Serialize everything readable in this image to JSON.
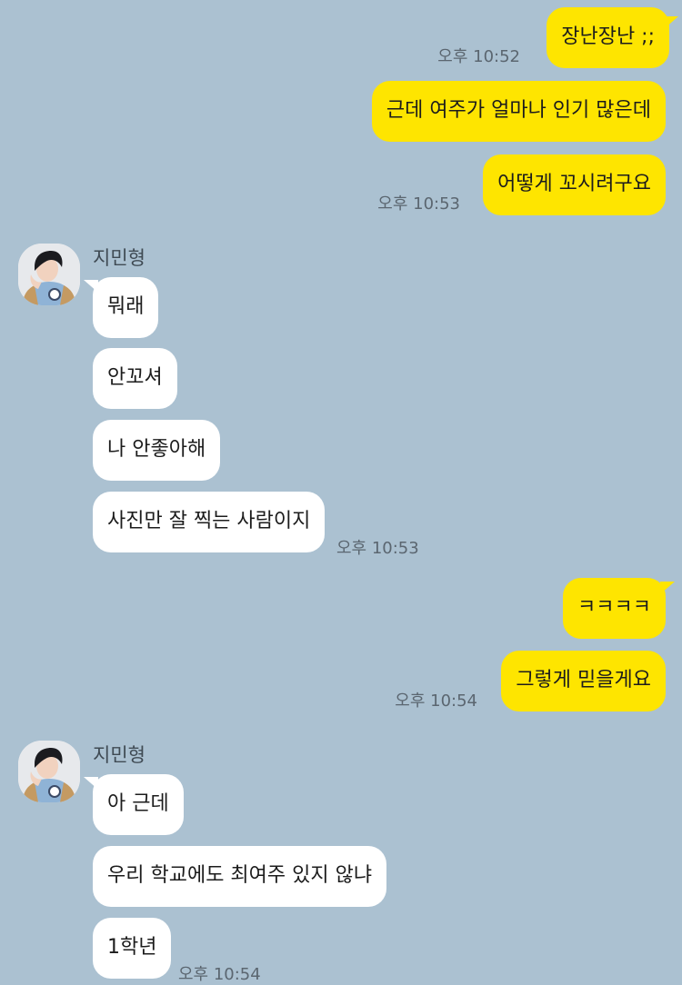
{
  "sender_name": "지민형",
  "messages": [
    {
      "from": "me",
      "text": "장난장난 ;;"
    },
    {
      "from": "me",
      "text": "근데 여주가 얼마나 인기 많은데"
    },
    {
      "from": "me",
      "text": "어떻게 꼬시려구요"
    },
    {
      "from": "peer",
      "text": "뭐래"
    },
    {
      "from": "peer",
      "text": "안꼬셔"
    },
    {
      "from": "peer",
      "text": "나 안좋아해"
    },
    {
      "from": "peer",
      "text": "사진만 잘 찍는 사람이지"
    },
    {
      "from": "me",
      "text": "ㅋㅋㅋㅋ"
    },
    {
      "from": "me",
      "text": "그렇게 믿을게요"
    },
    {
      "from": "peer",
      "text": "아 근데"
    },
    {
      "from": "peer",
      "text": "우리 학교에도 최여주 있지 않냐"
    },
    {
      "from": "peer",
      "text": "1학년"
    }
  ],
  "times": {
    "t1": "오후 10:52",
    "t2": "오후 10:53",
    "t3": "오후 10:53",
    "t4": "오후 10:54",
    "t5": "오후 10:54"
  },
  "colors": {
    "background": "#abc1d1",
    "my_bubble": "#fee500",
    "peer_bubble": "#ffffff"
  },
  "icons": {
    "avatar": "profile-photo"
  }
}
